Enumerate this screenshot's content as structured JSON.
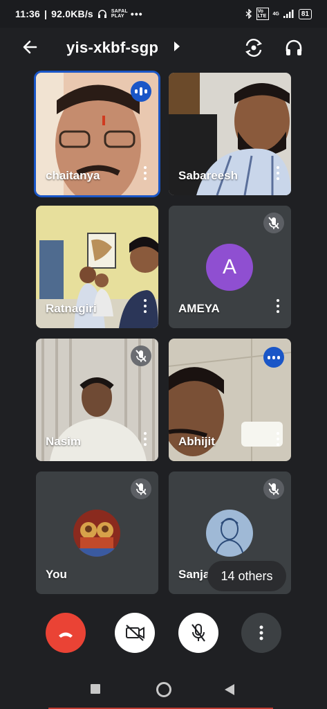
{
  "status": {
    "time": "11:36",
    "speed": "92.0KB/s",
    "battery": "81",
    "network": "4G",
    "volte": "Vo LTE",
    "app_badge": "SAFAL PLAY"
  },
  "header": {
    "title": "yis-xkbf-sgp"
  },
  "participants": [
    {
      "name": "chaitanya"
    },
    {
      "name": "Sabareesh"
    },
    {
      "name": "Ratnagiri"
    },
    {
      "name": "AMEYA",
      "avatar_letter": "A"
    },
    {
      "name": "Nasim"
    },
    {
      "name": "Abhijit"
    },
    {
      "name": "You"
    },
    {
      "name": "Sanjay"
    }
  ],
  "others_label": "14 others",
  "colors": {
    "background": "#1f2023",
    "tile": "#3c4043",
    "accent_blue": "#1a56c7",
    "end_call": "#ea4335",
    "avatar_purple": "#8f4fd1"
  },
  "icons": {
    "back": "arrow-left-icon",
    "switch_camera": "switch-camera-icon",
    "audio": "headphones-icon",
    "mic_off": "mic-off-icon",
    "speaking": "speaking-indicator-icon",
    "more": "more-vert-icon",
    "end_call": "call-end-icon",
    "camera_off": "camera-off-icon"
  }
}
